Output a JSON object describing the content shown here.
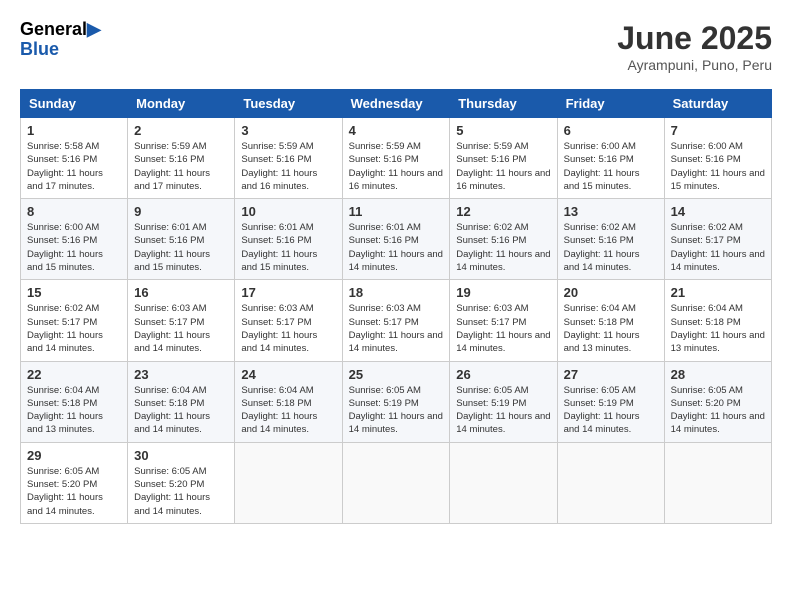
{
  "header": {
    "logo": {
      "general": "General",
      "blue": "Blue"
    },
    "title": "June 2025",
    "subtitle": "Ayrampuni, Puno, Peru"
  },
  "weekdays": [
    "Sunday",
    "Monday",
    "Tuesday",
    "Wednesday",
    "Thursday",
    "Friday",
    "Saturday"
  ],
  "weeks": [
    [
      {
        "day": 1,
        "sunrise": "5:58 AM",
        "sunset": "5:16 PM",
        "daylight": "11 hours and 17 minutes."
      },
      {
        "day": 2,
        "sunrise": "5:59 AM",
        "sunset": "5:16 PM",
        "daylight": "11 hours and 17 minutes."
      },
      {
        "day": 3,
        "sunrise": "5:59 AM",
        "sunset": "5:16 PM",
        "daylight": "11 hours and 16 minutes."
      },
      {
        "day": 4,
        "sunrise": "5:59 AM",
        "sunset": "5:16 PM",
        "daylight": "11 hours and 16 minutes."
      },
      {
        "day": 5,
        "sunrise": "5:59 AM",
        "sunset": "5:16 PM",
        "daylight": "11 hours and 16 minutes."
      },
      {
        "day": 6,
        "sunrise": "6:00 AM",
        "sunset": "5:16 PM",
        "daylight": "11 hours and 15 minutes."
      },
      {
        "day": 7,
        "sunrise": "6:00 AM",
        "sunset": "5:16 PM",
        "daylight": "11 hours and 15 minutes."
      }
    ],
    [
      {
        "day": 8,
        "sunrise": "6:00 AM",
        "sunset": "5:16 PM",
        "daylight": "11 hours and 15 minutes."
      },
      {
        "day": 9,
        "sunrise": "6:01 AM",
        "sunset": "5:16 PM",
        "daylight": "11 hours and 15 minutes."
      },
      {
        "day": 10,
        "sunrise": "6:01 AM",
        "sunset": "5:16 PM",
        "daylight": "11 hours and 15 minutes."
      },
      {
        "day": 11,
        "sunrise": "6:01 AM",
        "sunset": "5:16 PM",
        "daylight": "11 hours and 14 minutes."
      },
      {
        "day": 12,
        "sunrise": "6:02 AM",
        "sunset": "5:16 PM",
        "daylight": "11 hours and 14 minutes."
      },
      {
        "day": 13,
        "sunrise": "6:02 AM",
        "sunset": "5:16 PM",
        "daylight": "11 hours and 14 minutes."
      },
      {
        "day": 14,
        "sunrise": "6:02 AM",
        "sunset": "5:17 PM",
        "daylight": "11 hours and 14 minutes."
      }
    ],
    [
      {
        "day": 15,
        "sunrise": "6:02 AM",
        "sunset": "5:17 PM",
        "daylight": "11 hours and 14 minutes."
      },
      {
        "day": 16,
        "sunrise": "6:03 AM",
        "sunset": "5:17 PM",
        "daylight": "11 hours and 14 minutes."
      },
      {
        "day": 17,
        "sunrise": "6:03 AM",
        "sunset": "5:17 PM",
        "daylight": "11 hours and 14 minutes."
      },
      {
        "day": 18,
        "sunrise": "6:03 AM",
        "sunset": "5:17 PM",
        "daylight": "11 hours and 14 minutes."
      },
      {
        "day": 19,
        "sunrise": "6:03 AM",
        "sunset": "5:17 PM",
        "daylight": "11 hours and 14 minutes."
      },
      {
        "day": 20,
        "sunrise": "6:04 AM",
        "sunset": "5:18 PM",
        "daylight": "11 hours and 13 minutes."
      },
      {
        "day": 21,
        "sunrise": "6:04 AM",
        "sunset": "5:18 PM",
        "daylight": "11 hours and 13 minutes."
      }
    ],
    [
      {
        "day": 22,
        "sunrise": "6:04 AM",
        "sunset": "5:18 PM",
        "daylight": "11 hours and 13 minutes."
      },
      {
        "day": 23,
        "sunrise": "6:04 AM",
        "sunset": "5:18 PM",
        "daylight": "11 hours and 14 minutes."
      },
      {
        "day": 24,
        "sunrise": "6:04 AM",
        "sunset": "5:18 PM",
        "daylight": "11 hours and 14 minutes."
      },
      {
        "day": 25,
        "sunrise": "6:05 AM",
        "sunset": "5:19 PM",
        "daylight": "11 hours and 14 minutes."
      },
      {
        "day": 26,
        "sunrise": "6:05 AM",
        "sunset": "5:19 PM",
        "daylight": "11 hours and 14 minutes."
      },
      {
        "day": 27,
        "sunrise": "6:05 AM",
        "sunset": "5:19 PM",
        "daylight": "11 hours and 14 minutes."
      },
      {
        "day": 28,
        "sunrise": "6:05 AM",
        "sunset": "5:20 PM",
        "daylight": "11 hours and 14 minutes."
      }
    ],
    [
      {
        "day": 29,
        "sunrise": "6:05 AM",
        "sunset": "5:20 PM",
        "daylight": "11 hours and 14 minutes."
      },
      {
        "day": 30,
        "sunrise": "6:05 AM",
        "sunset": "5:20 PM",
        "daylight": "11 hours and 14 minutes."
      },
      null,
      null,
      null,
      null,
      null
    ]
  ],
  "labels": {
    "sunrise": "Sunrise:",
    "sunset": "Sunset:",
    "daylight": "Daylight:"
  }
}
